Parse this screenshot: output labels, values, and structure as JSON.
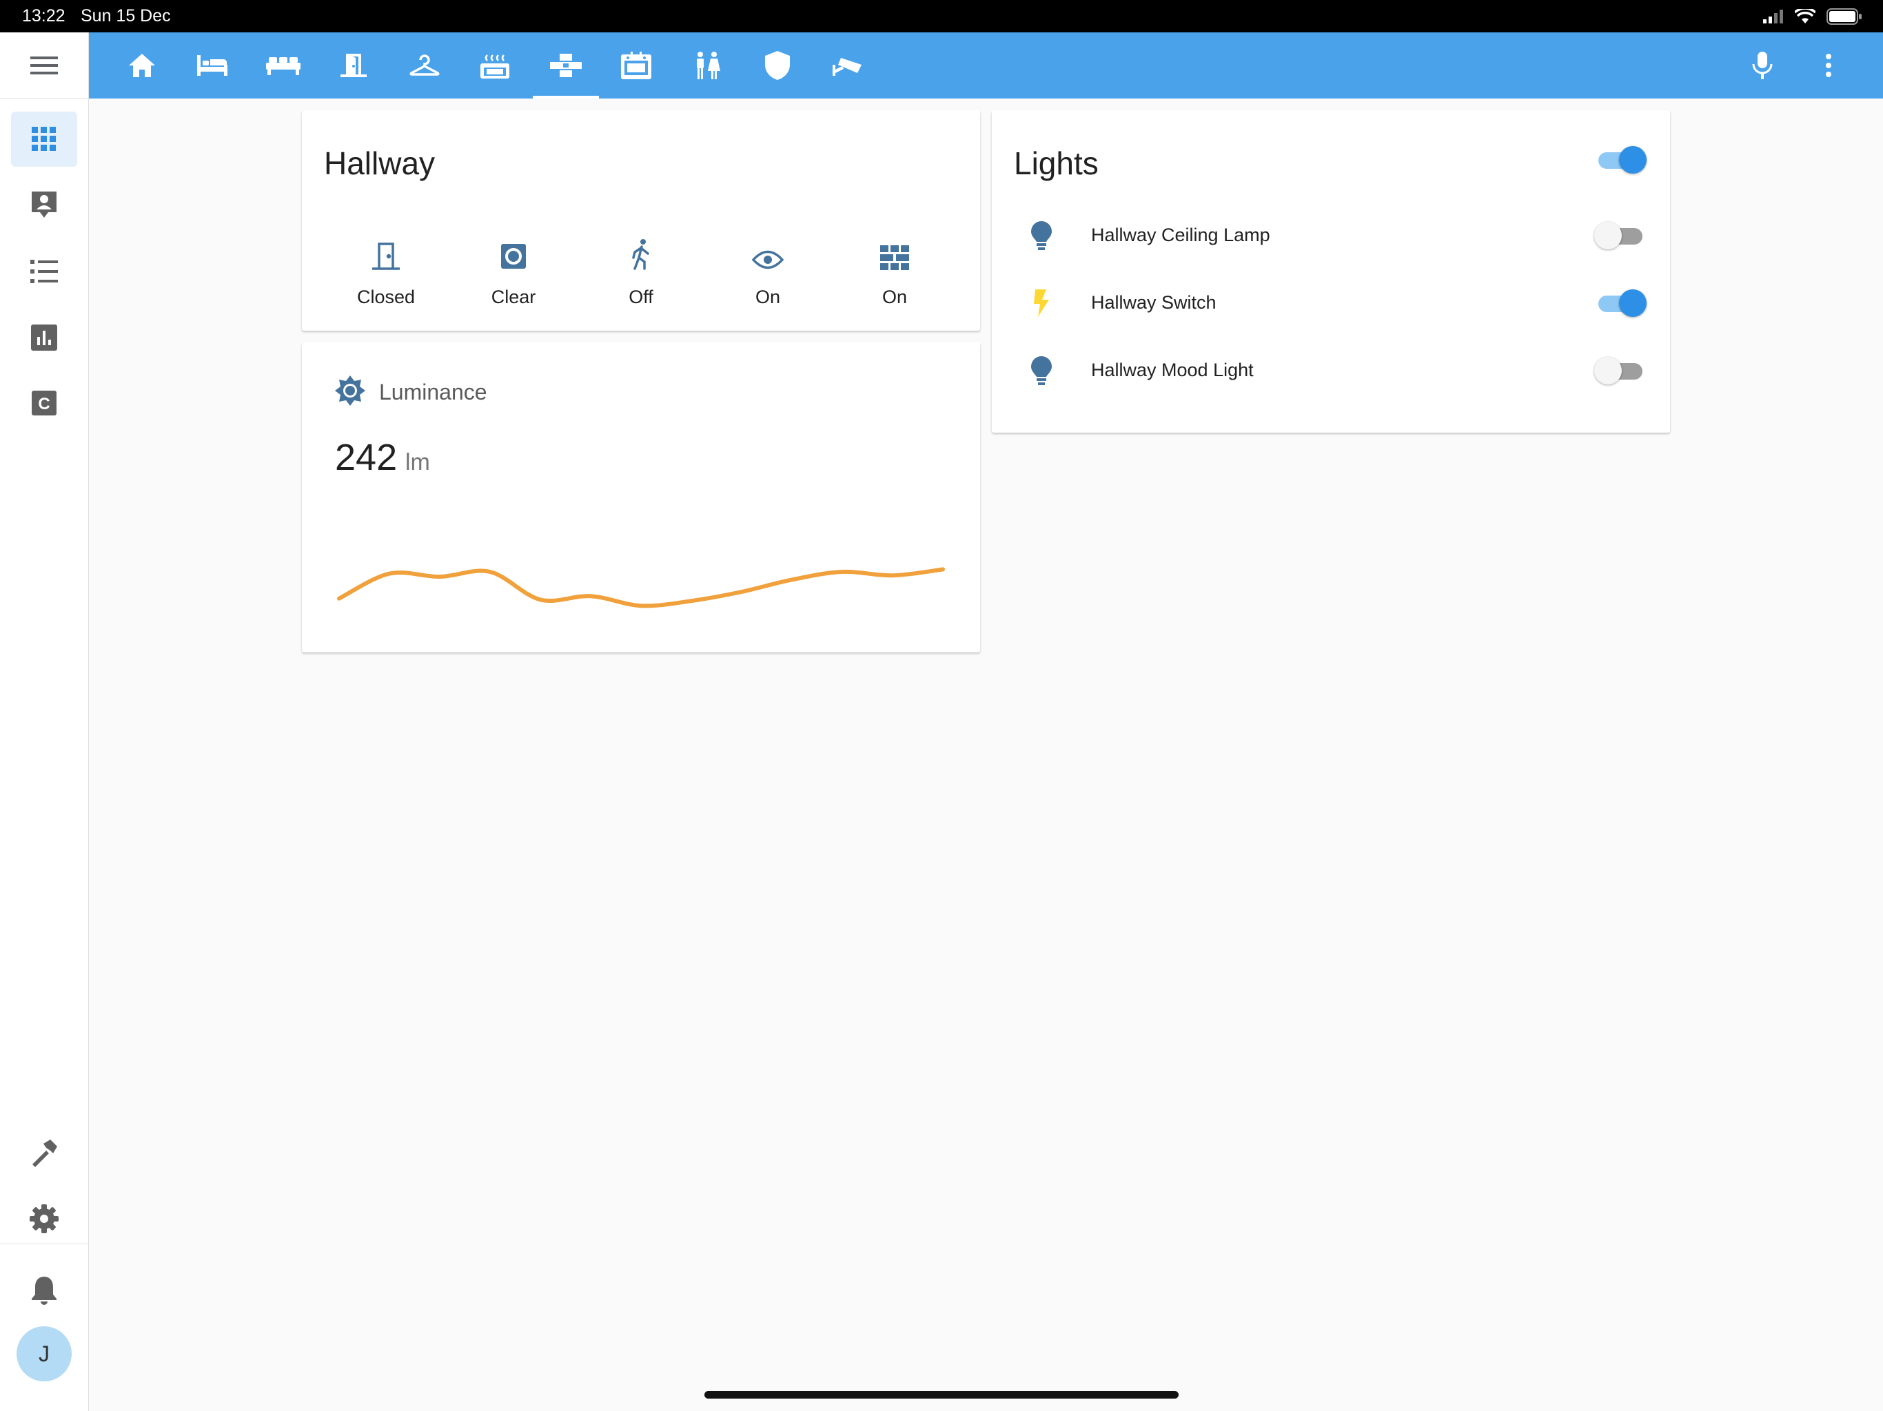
{
  "status_bar": {
    "time": "13:22",
    "date": "Sun 15 Dec",
    "battery_level": 1.0
  },
  "colors": {
    "toolbar": "#4aa3ea",
    "toggle_on": "#2d8fe6",
    "sparkline": "#f0a13c",
    "entity_icon": "#44739e",
    "switch_icon": "#fdd835"
  },
  "sidebar": {
    "menu_icon": "hamburger-menu-icon",
    "items": [
      {
        "icon": "overview-grid-icon",
        "active": true
      },
      {
        "icon": "map-account-icon",
        "active": false
      },
      {
        "icon": "logbook-list-icon",
        "active": false
      },
      {
        "icon": "history-chart-icon",
        "active": false
      },
      {
        "icon": "hacs-c-icon",
        "active": false
      }
    ],
    "bottom_items": [
      {
        "icon": "developer-tools-hammer-icon"
      },
      {
        "icon": "settings-gear-icon"
      },
      {
        "icon": "notifications-bell-icon"
      }
    ],
    "avatar_initial": "J"
  },
  "toolbar": {
    "tabs": [
      {
        "icon": "home-icon",
        "active": false
      },
      {
        "icon": "bed-icon",
        "active": false
      },
      {
        "icon": "sofa-icon",
        "active": false
      },
      {
        "icon": "door-icon",
        "active": false
      },
      {
        "icon": "hanger-icon",
        "active": false
      },
      {
        "icon": "stove-icon",
        "active": false
      },
      {
        "icon": "floor-plan-icon",
        "active": true
      },
      {
        "icon": "toaster-oven-icon",
        "active": false
      },
      {
        "icon": "human-male-female-icon",
        "active": false
      },
      {
        "icon": "shield-icon",
        "active": false
      },
      {
        "icon": "cctv-icon",
        "active": false
      }
    ],
    "actions": [
      {
        "icon": "microphone-icon"
      },
      {
        "icon": "more-vertical-icon"
      }
    ]
  },
  "hallway_card": {
    "title": "Hallway",
    "entities": [
      {
        "icon": "door-closed-icon",
        "state": "Closed"
      },
      {
        "icon": "smoke-detector-icon",
        "state": "Clear"
      },
      {
        "icon": "motion-walk-icon",
        "state": "Off"
      },
      {
        "icon": "eye-icon",
        "state": "On"
      },
      {
        "icon": "wall-icon",
        "state": "On"
      }
    ]
  },
  "luminance_card": {
    "name": "Luminance",
    "icon": "brightness-sun-icon",
    "value": "242",
    "unit": "lm",
    "sparkline": [
      0.14,
      0.55,
      0.5,
      0.58,
      0.12,
      0.18,
      0.02,
      0.1,
      0.25,
      0.45,
      0.58,
      0.52,
      0.62
    ]
  },
  "lights_card": {
    "title": "Lights",
    "header_toggle_on": true,
    "rows": [
      {
        "icon": "lightbulb-icon",
        "name": "Hallway Ceiling Lamp",
        "on": false
      },
      {
        "icon": "flash-icon",
        "name": "Hallway Switch",
        "on": true
      },
      {
        "icon": "lightbulb-icon",
        "name": "Hallway Mood Light",
        "on": false
      }
    ]
  }
}
